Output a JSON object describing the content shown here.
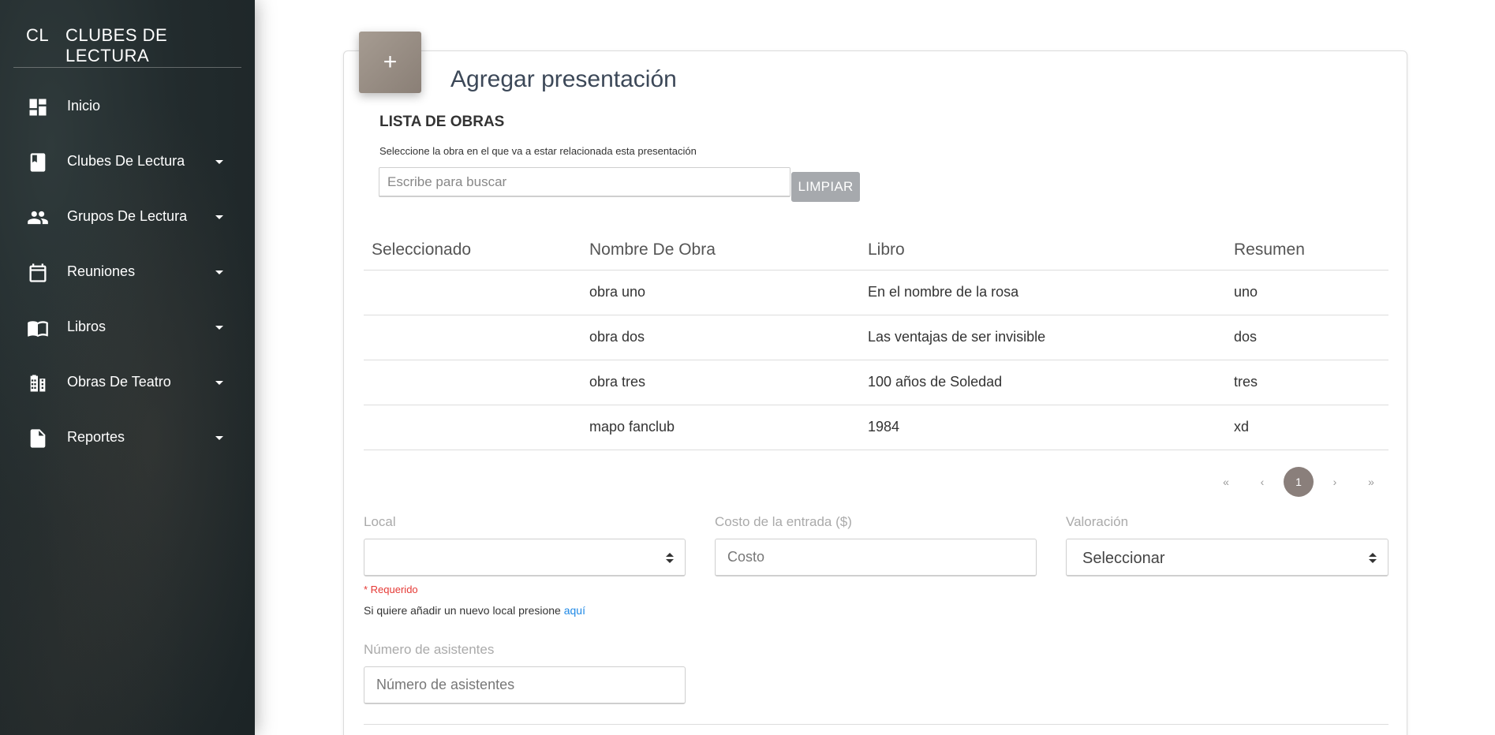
{
  "sidebar": {
    "brand_mini": "CL",
    "brand_text": "CLUBES DE LECTURA",
    "items": [
      {
        "label": "Inicio",
        "icon": "dashboard-icon"
      },
      {
        "label": "Clubes De Lectura",
        "icon": "book-icon"
      },
      {
        "label": "Grupos De Lectura",
        "icon": "people-icon"
      },
      {
        "label": "Reuniones",
        "icon": "calendar-icon"
      },
      {
        "label": "Libros",
        "icon": "open-book-icon"
      },
      {
        "label": "Obras De Teatro",
        "icon": "theater-icon"
      },
      {
        "label": "Reportes",
        "icon": "document-icon"
      }
    ]
  },
  "card": {
    "icon_glyph": "+",
    "title": "Agregar presentación"
  },
  "works": {
    "title": "LISTA DE OBRAS",
    "description": "Seleccione la obra en el que va a estar relacionada esta presentación",
    "search_placeholder": "Escribe para buscar",
    "clear_label": "LIMPIAR",
    "columns": [
      "Seleccionado",
      "Nombre De Obra",
      "Libro",
      "Resumen"
    ],
    "rows": [
      {
        "selected": "",
        "name": "obra uno",
        "book": "En el nombre de la rosa",
        "summary": "uno"
      },
      {
        "selected": "",
        "name": "obra dos",
        "book": "Las ventajas de ser invisible",
        "summary": "dos"
      },
      {
        "selected": "",
        "name": "obra tres",
        "book": "100 años de Soledad",
        "summary": "tres"
      },
      {
        "selected": "",
        "name": "mapo fanclub",
        "book": "1984",
        "summary": "xd"
      }
    ],
    "pagination": {
      "first": "«",
      "prev": "‹",
      "current": "1",
      "next": "›",
      "last": "»"
    }
  },
  "form": {
    "local_label": "Local",
    "local_value": "",
    "required_text": "* Requerido",
    "hint_text": "Si quiere añadir un nuevo local presione ",
    "hint_link": "aquí",
    "cost_label": "Costo de la entrada ($)",
    "cost_placeholder": "Costo",
    "rating_label": "Valoración",
    "rating_value": "Seleccionar",
    "attendees_label": "Número de asistentes",
    "attendees_placeholder": "Número de asistentes"
  },
  "colors": {
    "sidebar_bg": "#222b2d",
    "accent": "#8a7f7b",
    "clear_button": "#a6a9ad",
    "required": "#e53935",
    "link": "#1e88e5"
  }
}
